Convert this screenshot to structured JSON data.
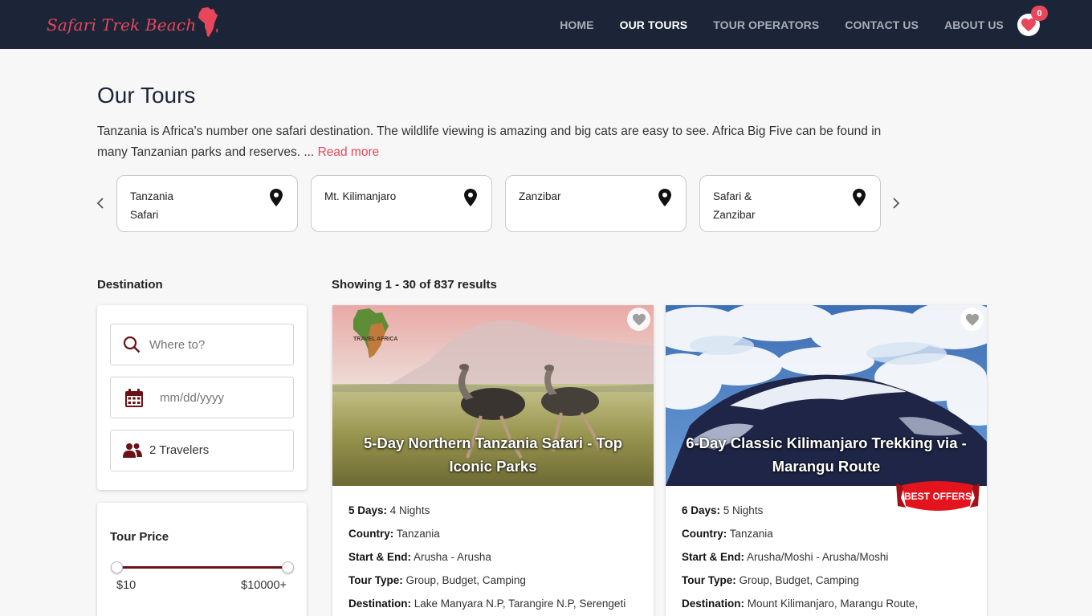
{
  "brand": {
    "name": "Safari Trek Beach",
    "accent": "#e8475b",
    "nav_bg": "#1c2538"
  },
  "nav": {
    "items": [
      {
        "label": "HOME",
        "active": false
      },
      {
        "label": "OUR TOURS",
        "active": true
      },
      {
        "label": "TOUR OPERATORS",
        "active": false
      },
      {
        "label": "CONTACT US",
        "active": false
      },
      {
        "label": "ABOUT US",
        "active": false
      }
    ],
    "cart_count": "0",
    "cart_icon": "heart-icon"
  },
  "page": {
    "title": "Our Tours",
    "intro": "Tanzania is Africa's number one safari destination. The wildlife viewing is amazing and big cats are easy to see. Africa Big Five can be found in many Tanzanian parks and reserves. ...",
    "read_more": "Read more"
  },
  "categories": [
    {
      "label": "Tanzania Safari",
      "icon": "map-pin-icon"
    },
    {
      "label": "Mt. Kilimanjaro",
      "icon": "map-pin-icon"
    },
    {
      "label": "Zanzibar",
      "icon": "map-pin-icon"
    },
    {
      "label": "Safari & Zanzibar",
      "icon": "map-pin-icon"
    }
  ],
  "sidebar": {
    "heading": "Destination",
    "where_placeholder": "Where to?",
    "date_placeholder": "mm/dd/yyyy",
    "travelers": "2 Travelers",
    "price": {
      "title": "Tour Price",
      "min_label": "$10",
      "max_label": "$10000+",
      "low_fraction": 0,
      "high_fraction": 1
    }
  },
  "results": {
    "count_text": "Showing 1 - 30 of 837 results",
    "tours": [
      {
        "title": "5-Day Northern Tanzania Safari - Top Iconic Parks",
        "operator_logo_text": "TRAVEL AFRICA",
        "days_label": "5 Days:",
        "days_value": "4 Nights",
        "country_label": "Country:",
        "country_value": "Tanzania",
        "startend_label": "Start & End:",
        "startend_value": "Arusha - Arusha",
        "type_label": "Tour Type:",
        "type_value": "Group, Budget, Camping",
        "dest_label": "Destination:",
        "dest_value": "Lake Manyara N.P, Tarangire N.P, Serengeti N.P, Ngorongoro Crater"
      },
      {
        "title": "6-Day Classic Kilimanjaro Trekking via - Marangu Route",
        "badge": "BEST OFFERS",
        "days_label": "6 Days:",
        "days_value": "5 Nights",
        "country_label": "Country:",
        "country_value": "Tanzania",
        "startend_label": "Start & End:",
        "startend_value": "Arusha/Moshi - Arusha/Moshi",
        "type_label": "Tour Type:",
        "type_value": "Group, Budget, Camping",
        "dest_label": "Destination:",
        "dest_value": "Mount Kilimanjaro, Marangu Route, Kilimanjaro Airport"
      }
    ]
  }
}
